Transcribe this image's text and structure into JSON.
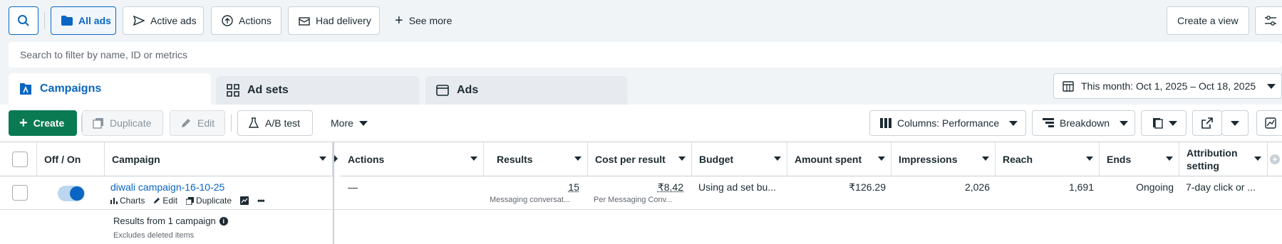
{
  "filters": {
    "all_ads": "All ads",
    "active_ads": "Active ads",
    "actions": "Actions",
    "had_delivery": "Had delivery",
    "see_more": "See more",
    "create_view": "Create a view"
  },
  "search": {
    "placeholder": "Search to filter by name, ID or metrics"
  },
  "tabs": [
    {
      "label": "Campaigns",
      "active": true
    },
    {
      "label": "Ad sets",
      "active": false
    },
    {
      "label": "Ads",
      "active": false
    }
  ],
  "date_range": "This month: Oct 1, 2025 – Oct 18, 2025",
  "toolbar": {
    "create": "Create",
    "duplicate": "Duplicate",
    "edit": "Edit",
    "ab_test": "A/B test",
    "more": "More",
    "columns": "Columns: Performance",
    "breakdown": "Breakdown"
  },
  "columns": {
    "off_on": "Off / On",
    "campaign": "Campaign",
    "actions": "Actions",
    "results": "Results",
    "cost_per_result": "Cost per result",
    "budget": "Budget",
    "amount_spent": "Amount spent",
    "impressions": "Impressions",
    "reach": "Reach",
    "ends": "Ends",
    "attribution": "Attribution setting"
  },
  "row": {
    "name": "diwali campaign-16-10-25",
    "charts": "Charts",
    "edit": "Edit",
    "duplicate": "Duplicate",
    "more": "•••",
    "actions": "—",
    "results": "15",
    "results_sub": "Messaging conversat...",
    "cost_per_result": "₹8.42",
    "cost_sub": "Per Messaging Conv...",
    "budget": "Using ad set bu...",
    "amount_spent": "₹126.29",
    "impressions": "2,026",
    "reach": "1,691",
    "ends": "Ongoing",
    "attribution": "7-day click or ..."
  },
  "summary": {
    "title": "Results from 1 campaign",
    "note": "Excludes deleted items"
  },
  "colors": {
    "accent": "#0a66c2",
    "create_green": "#0a7a52",
    "toggle_on": "#0a66c2"
  }
}
